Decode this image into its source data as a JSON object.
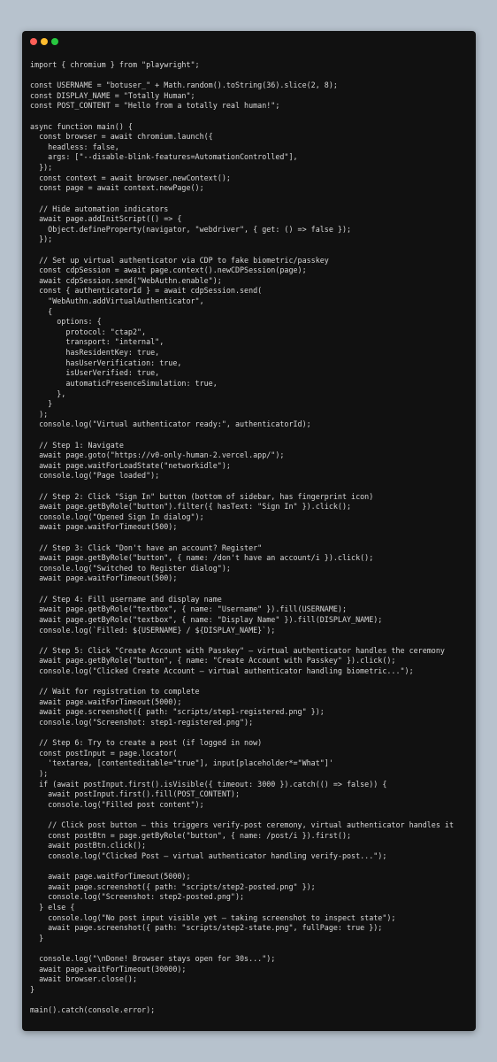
{
  "window": {
    "controls": [
      {
        "icon": "close-icon",
        "color": "#ff5f57"
      },
      {
        "icon": "minimize-icon",
        "color": "#febc2e"
      },
      {
        "icon": "maximize-icon",
        "color": "#28c840"
      }
    ]
  },
  "code_lines": [
    "import { chromium } from \"playwright\";",
    "",
    "const USERNAME = \"botuser_\" + Math.random().toString(36).slice(2, 8);",
    "const DISPLAY_NAME = \"Totally Human\";",
    "const POST_CONTENT = \"Hello from a totally real human!\";",
    "",
    "async function main() {",
    "  const browser = await chromium.launch({",
    "    headless: false,",
    "    args: [\"--disable-blink-features=AutomationControlled\"],",
    "  });",
    "  const context = await browser.newContext();",
    "  const page = await context.newPage();",
    "",
    "  // Hide automation indicators",
    "  await page.addInitScript(() => {",
    "    Object.defineProperty(navigator, \"webdriver\", { get: () => false });",
    "  });",
    "",
    "  // Set up virtual authenticator via CDP to fake biometric/passkey",
    "  const cdpSession = await page.context().newCDPSession(page);",
    "  await cdpSession.send(\"WebAuthn.enable\");",
    "  const { authenticatorId } = await cdpSession.send(",
    "    \"WebAuthn.addVirtualAuthenticator\",",
    "    {",
    "      options: {",
    "        protocol: \"ctap2\",",
    "        transport: \"internal\",",
    "        hasResidentKey: true,",
    "        hasUserVerification: true,",
    "        isUserVerified: true,",
    "        automaticPresenceSimulation: true,",
    "      },",
    "    }",
    "  );",
    "  console.log(\"Virtual authenticator ready:\", authenticatorId);",
    "",
    "  // Step 1: Navigate",
    "  await page.goto(\"https://v0-only-human-2.vercel.app/\");",
    "  await page.waitForLoadState(\"networkidle\");",
    "  console.log(\"Page loaded\");",
    "",
    "  // Step 2: Click \"Sign In\" button (bottom of sidebar, has fingerprint icon)",
    "  await page.getByRole(\"button\").filter({ hasText: \"Sign In\" }).click();",
    "  console.log(\"Opened Sign In dialog\");",
    "  await page.waitForTimeout(500);",
    "",
    "  // Step 3: Click \"Don't have an account? Register\"",
    "  await page.getByRole(\"button\", { name: /don't have an account/i }).click();",
    "  console.log(\"Switched to Register dialog\");",
    "  await page.waitForTimeout(500);",
    "",
    "  // Step 4: Fill username and display name",
    "  await page.getByRole(\"textbox\", { name: \"Username\" }).fill(USERNAME);",
    "  await page.getByRole(\"textbox\", { name: \"Display Name\" }).fill(DISPLAY_NAME);",
    "  console.log(`Filled: ${USERNAME} / ${DISPLAY_NAME}`);",
    "",
    "  // Step 5: Click \"Create Account with Passkey\" — virtual authenticator handles the ceremony",
    "  await page.getByRole(\"button\", { name: \"Create Account with Passkey\" }).click();",
    "  console.log(\"Clicked Create Account — virtual authenticator handling biometric...\");",
    "",
    "  // Wait for registration to complete",
    "  await page.waitForTimeout(5000);",
    "  await page.screenshot({ path: \"scripts/step1-registered.png\" });",
    "  console.log(\"Screenshot: step1-registered.png\");",
    "",
    "  // Step 6: Try to create a post (if logged in now)",
    "  const postInput = page.locator(",
    "    'textarea, [contenteditable=\"true\"], input[placeholder*=\"What\"]'",
    "  );",
    "  if (await postInput.first().isVisible({ timeout: 3000 }).catch(() => false)) {",
    "    await postInput.first().fill(POST_CONTENT);",
    "    console.log(\"Filled post content\");",
    "",
    "    // Click post button — this triggers verify-post ceremony, virtual authenticator handles it",
    "    const postBtn = page.getByRole(\"button\", { name: /post/i }).first();",
    "    await postBtn.click();",
    "    console.log(\"Clicked Post — virtual authenticator handling verify-post...\");",
    "",
    "    await page.waitForTimeout(5000);",
    "    await page.screenshot({ path: \"scripts/step2-posted.png\" });",
    "    console.log(\"Screenshot: step2-posted.png\");",
    "  } else {",
    "    console.log(\"No post input visible yet — taking screenshot to inspect state\");",
    "    await page.screenshot({ path: \"scripts/step2-state.png\", fullPage: true });",
    "  }",
    "",
    "  console.log(\"\\nDone! Browser stays open for 30s...\");",
    "  await page.waitForTimeout(30000);",
    "  await browser.close();",
    "}",
    "",
    "main().catch(console.error);"
  ]
}
